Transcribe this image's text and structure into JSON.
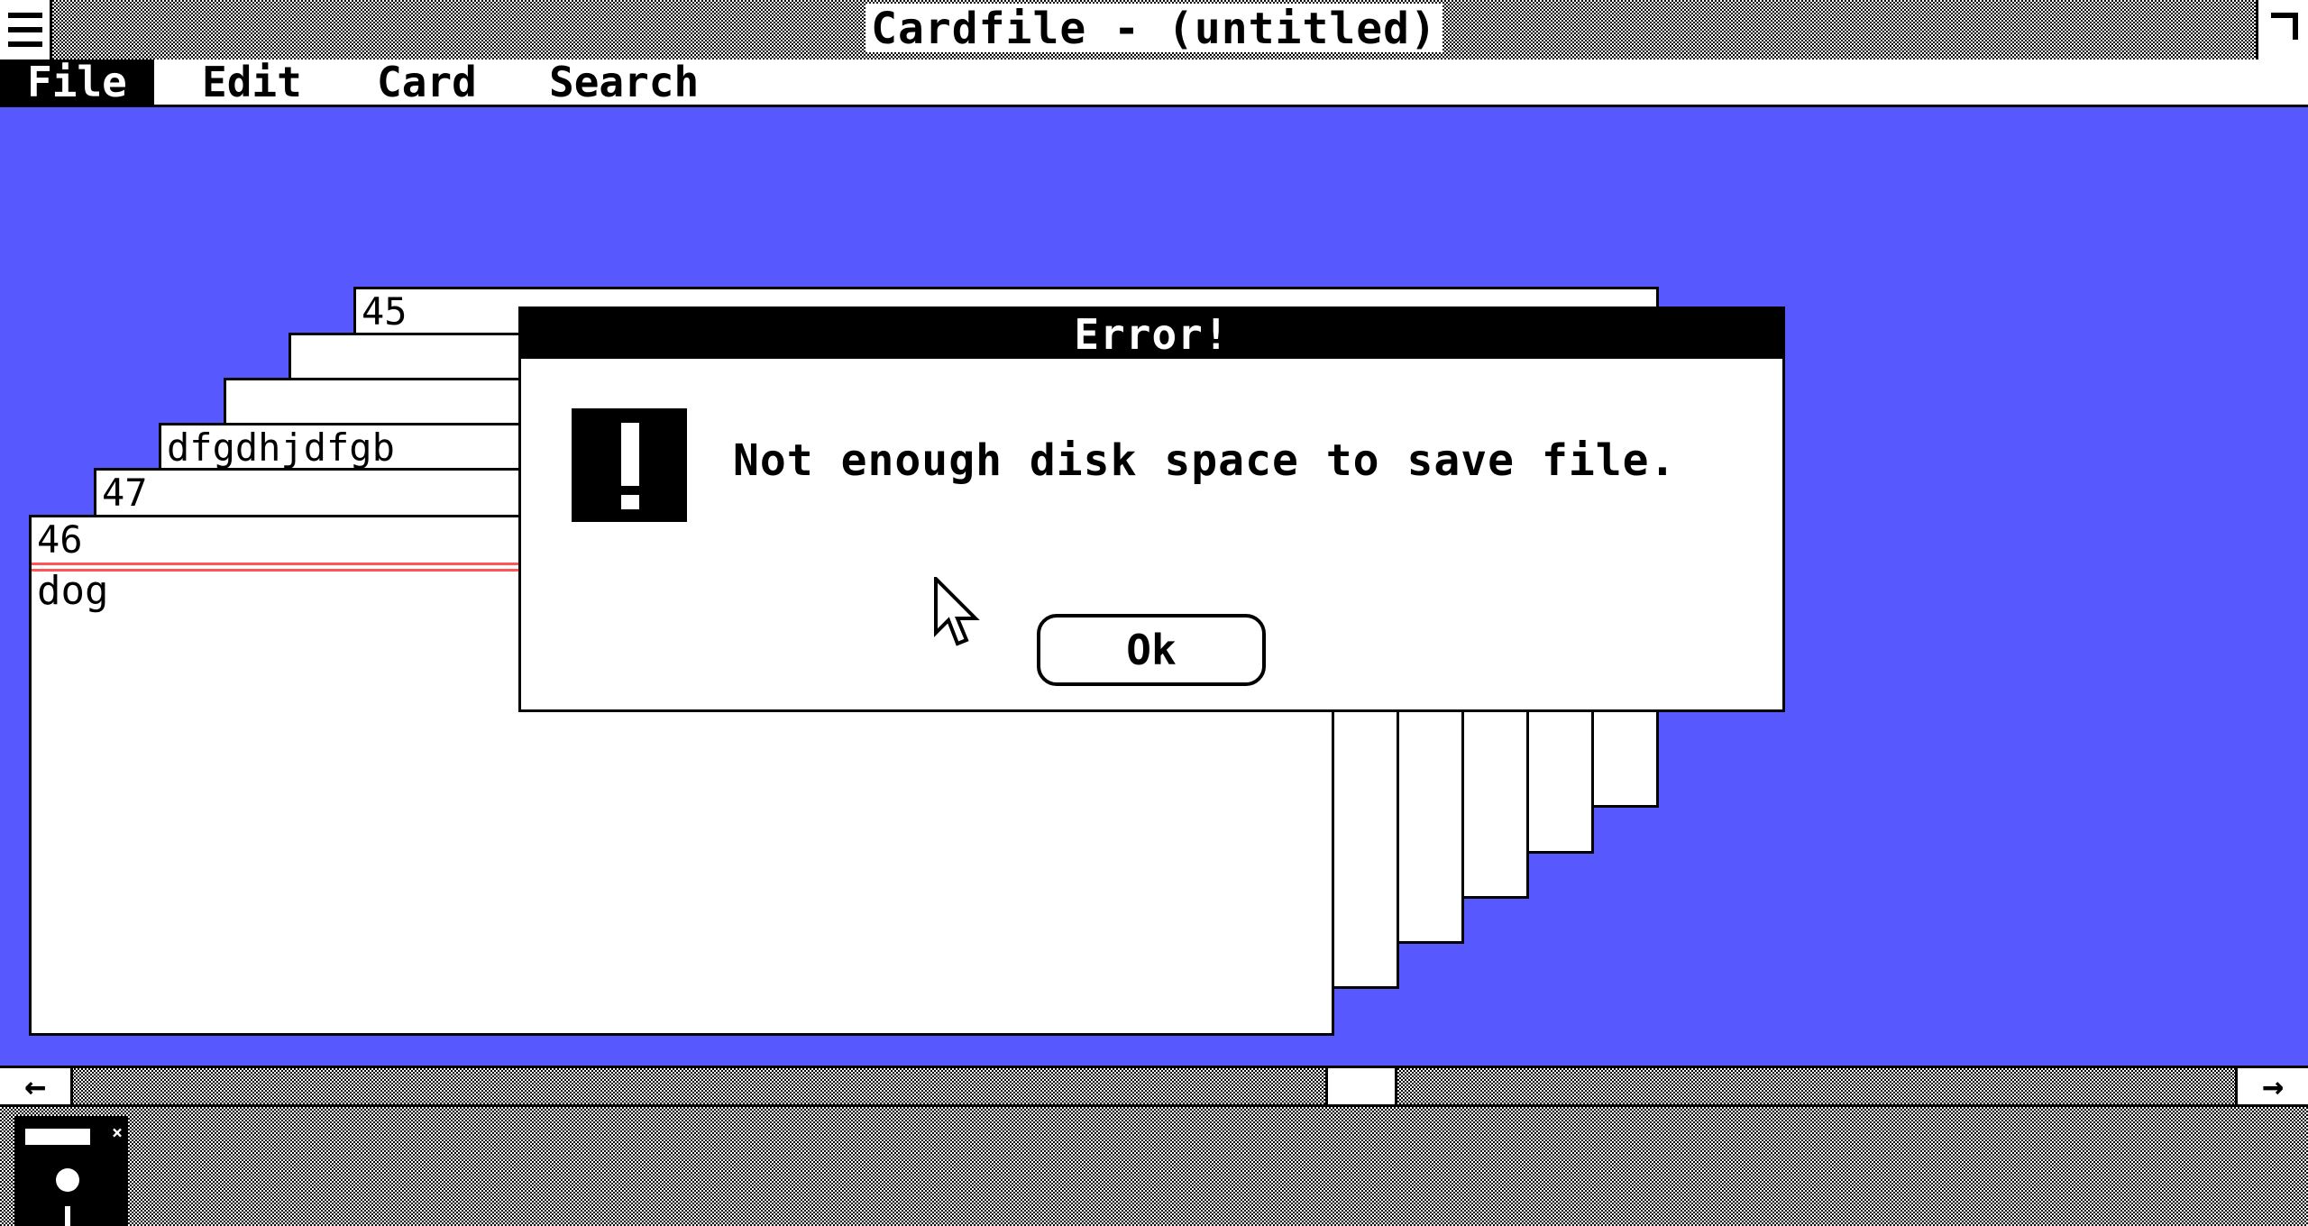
{
  "window": {
    "title": "Cardfile - (untitled)"
  },
  "menubar": {
    "items": [
      {
        "label": "File",
        "active": true
      },
      {
        "label": "Edit",
        "active": false
      },
      {
        "label": "Card",
        "active": false
      },
      {
        "label": "Search",
        "active": false
      }
    ]
  },
  "cards": {
    "back_titles": [
      "45",
      "",
      "",
      "dfgdhjdfgb",
      "47"
    ],
    "front": {
      "title": "46",
      "body": "dog"
    }
  },
  "dialog": {
    "title": "Error!",
    "message": "Not enough disk space to save file.",
    "ok_label": "Ok",
    "icon": "exclamation-icon"
  },
  "scrollbar": {
    "left_arrow": "←",
    "right_arrow": "→"
  },
  "colors": {
    "workspace": "#5858ff",
    "card_line": "#ff5555"
  }
}
